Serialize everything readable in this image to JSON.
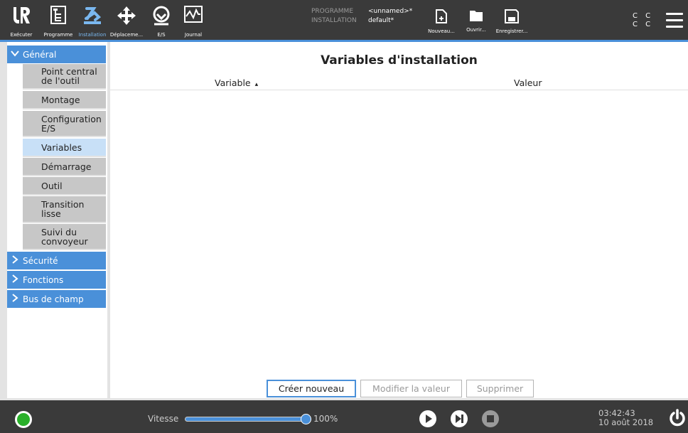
{
  "toolbar": {
    "tabs": [
      {
        "label": "Exécuter",
        "icon": "ur-logo-icon"
      },
      {
        "label": "Programme",
        "icon": "program-tree-icon"
      },
      {
        "label": "Installation",
        "icon": "installation-arm-icon",
        "active": true
      },
      {
        "label": "Déplaceme...",
        "icon": "move-arrows-icon"
      },
      {
        "label": "E/S",
        "icon": "io-icon"
      },
      {
        "label": "Journal",
        "icon": "log-chart-icon"
      }
    ],
    "program_key": "PROGRAMME",
    "program_value": "<unnamed>*",
    "installation_key": "INSTALLATION",
    "installation_value": "default*",
    "new_label": "Nouveau...",
    "open_label": "Ouvrir...",
    "save_label": "Enregistrer...",
    "cc_top": "C C",
    "cc_bottom": "C C"
  },
  "sidebar": {
    "sections": [
      {
        "label": "Général",
        "expanded": true
      },
      {
        "label": "Sécurité",
        "expanded": false
      },
      {
        "label": "Fonctions",
        "expanded": false
      },
      {
        "label": "Bus de champ",
        "expanded": false
      }
    ],
    "general_items": [
      "Point central de l'outil",
      "Montage",
      "Configuration E/S",
      "Variables",
      "Démarrage",
      "Outil",
      "Transition lisse",
      "Suivi du convoyeur"
    ],
    "selected_item": "Variables"
  },
  "main": {
    "title": "Variables d'installation",
    "col_variable": "Variable",
    "col_sort_icon": "▴",
    "col_value": "Valeur",
    "btn_create": "Créer nouveau",
    "btn_modify": "Modifier la valeur",
    "btn_delete": "Supprimer"
  },
  "bottom": {
    "speed_label": "Vitesse",
    "speed_value": "100%",
    "speed_fraction": 1.0,
    "time": "03:42:43",
    "date": "10 août 2018"
  },
  "colors": {
    "accent": "#4a90d9",
    "bar": "#3a3a3a",
    "status_ok": "#2ab02a",
    "selected_bg": "#c8e0f7"
  }
}
